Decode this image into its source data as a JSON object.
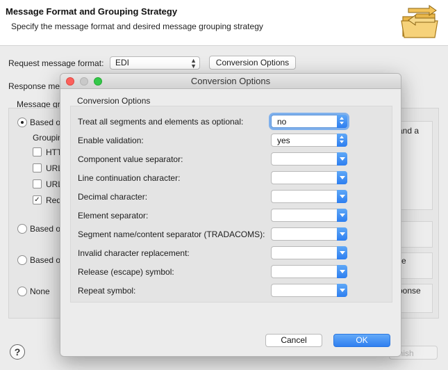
{
  "wizard": {
    "title": "Message Format and Grouping Strategy",
    "description": "Specify the message format and desired message grouping strategy",
    "request_format_label": "Request message format:",
    "request_format_value": "EDI",
    "conversion_options_button": "Conversion Options",
    "response_label_partial": "Response mes",
    "message_group_partial": "Message gro",
    "grouping_partial": "Groupin",
    "radio_options": [
      {
        "label": "Based o",
        "selected": true
      },
      {
        "label": "Based o",
        "selected": false
      },
      {
        "label": "Based o",
        "selected": false
      },
      {
        "label": "None",
        "selected": false
      }
    ],
    "checkbox_options": [
      {
        "label": "HTT",
        "checked": false
      },
      {
        "label": "URL",
        "checked": false
      },
      {
        "label": "URL",
        "checked": false
      },
      {
        "label": "Req",
        "checked": true
      }
    ],
    "right_fragments": [
      "and a",
      "e",
      "ponse"
    ],
    "finish_partial": "inish",
    "help_symbol": "?"
  },
  "dialog": {
    "title": "Conversion Options",
    "section_label": "Conversion Options",
    "rows": [
      {
        "label": "Treat all segments and elements as optional:",
        "value": "no",
        "kind": "updown",
        "focused": true
      },
      {
        "label": "Enable validation:",
        "value": "yes",
        "kind": "updown",
        "focused": false
      },
      {
        "label": "Component value separator:",
        "value": "",
        "kind": "down",
        "focused": false
      },
      {
        "label": "Line continuation character:",
        "value": "",
        "kind": "down",
        "focused": false
      },
      {
        "label": "Decimal character:",
        "value": "",
        "kind": "down",
        "focused": false
      },
      {
        "label": "Element separator:",
        "value": "",
        "kind": "down",
        "focused": false
      },
      {
        "label": "Segment name/content separator (TRADACOMS):",
        "value": "",
        "kind": "down",
        "focused": false
      },
      {
        "label": "Invalid character replacement:",
        "value": "",
        "kind": "down",
        "focused": false
      },
      {
        "label": "Release (escape) symbol:",
        "value": "",
        "kind": "down",
        "focused": false
      },
      {
        "label": "Repeat symbol:",
        "value": "",
        "kind": "down",
        "focused": false
      }
    ],
    "cancel_button": "Cancel",
    "ok_button": "OK"
  },
  "colors": {
    "accent_blue": "#2f7ff0",
    "close_red": "#fc605c",
    "zoom_green": "#34c84a"
  }
}
